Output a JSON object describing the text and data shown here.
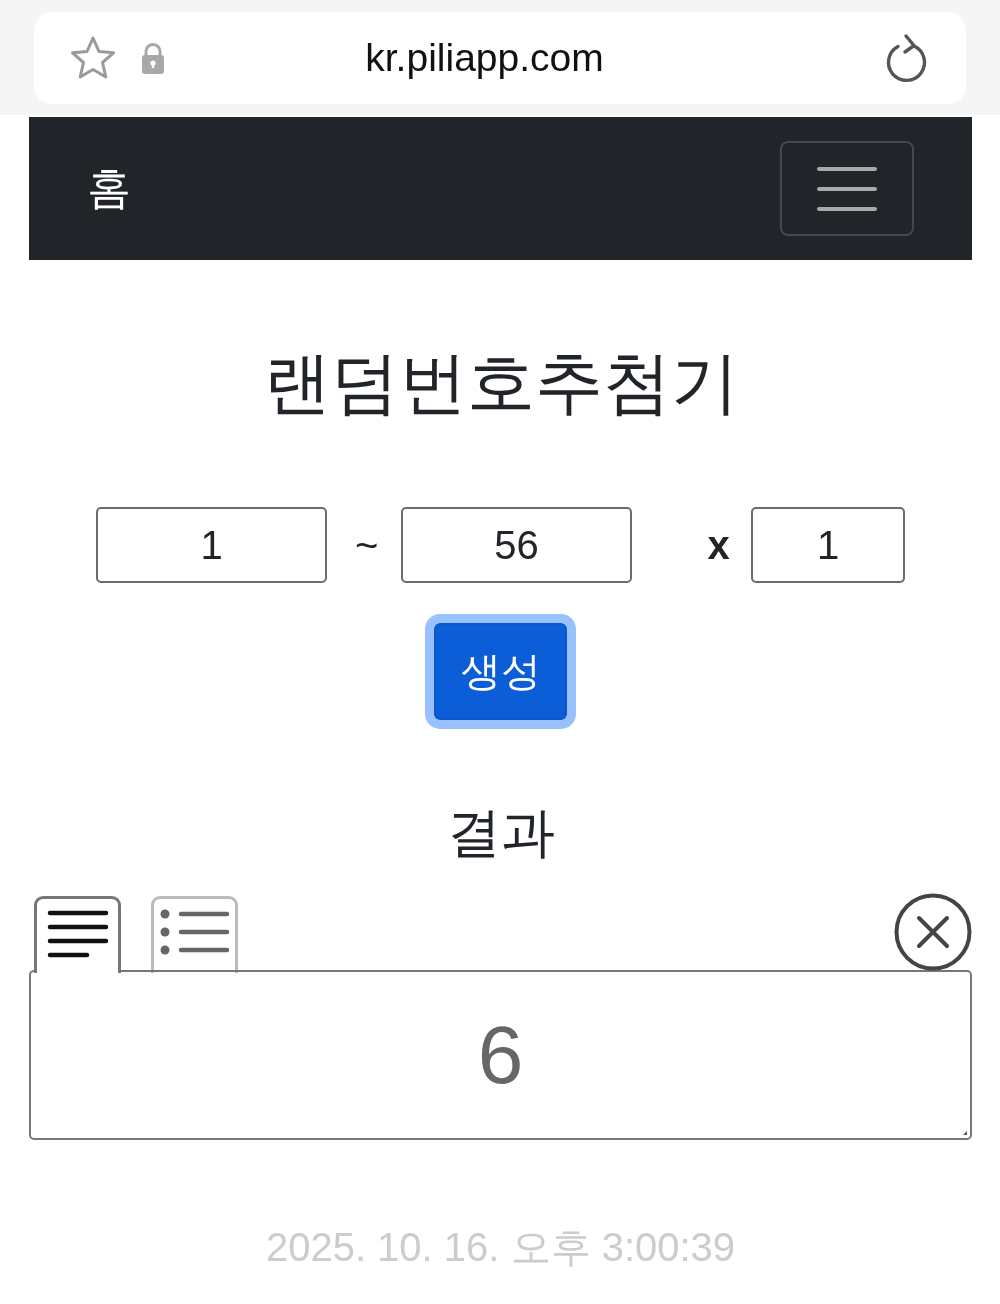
{
  "browser": {
    "url": "kr.piliapp.com"
  },
  "navbar": {
    "brand": "홈"
  },
  "title": "랜덤번호추첨기",
  "range": {
    "min": "1",
    "separator": "~",
    "max": "56",
    "times_label": "x",
    "count": "1"
  },
  "generate_button": "생성",
  "result": {
    "heading": "결과",
    "views": [
      {
        "kind": "text",
        "selected": true
      },
      {
        "kind": "list",
        "selected": false
      }
    ],
    "value": "6"
  },
  "timestamp": "2025. 10. 16. 오후 3:00:39"
}
